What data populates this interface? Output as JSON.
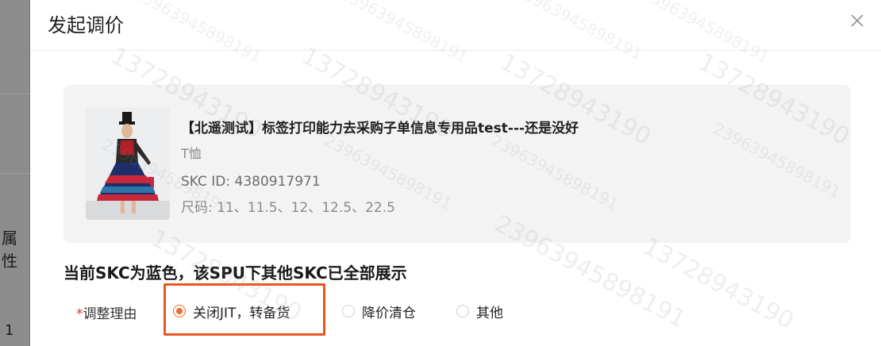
{
  "backdrop": {
    "label_attr": "属性",
    "label_num": "1"
  },
  "modal": {
    "title": "发起调价",
    "close_icon": "close-icon"
  },
  "product": {
    "title": "【北遥测试】标签打印能力去采购子单信息专用品test---还是没好",
    "category": "T恤",
    "skc_id": "SKC ID: 4380917971",
    "sizes": "尺码: 11、11.5、12、12.5、22.5"
  },
  "note": "当前SKC为蓝色，该SPU下其他SKC已全部展示",
  "reason": {
    "required_mark": "*",
    "label": "调整理由",
    "options": [
      {
        "label": "关闭JIT，转备货",
        "selected": true
      },
      {
        "label": "降价清仓",
        "selected": false
      },
      {
        "label": "其他",
        "selected": false
      }
    ]
  },
  "watermarks": {
    "id_a": "13728943190",
    "id_b": "23963945898191"
  },
  "colors": {
    "accent": "#f2692a",
    "highlight_border": "#e8561f",
    "required": "#e0301e",
    "card_bg": "#f3f3f3"
  }
}
